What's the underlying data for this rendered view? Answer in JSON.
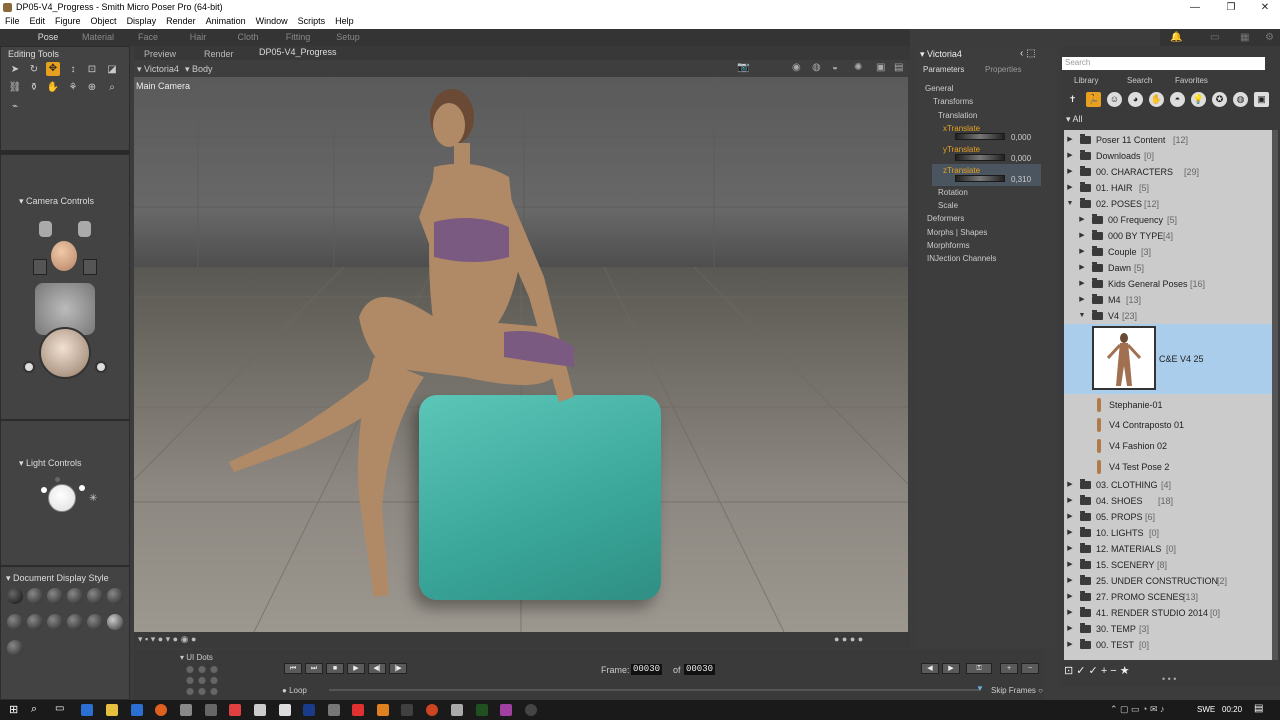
{
  "window": {
    "title": "DP05-V4_Progress - Smith Micro Poser Pro  (64-bit)"
  },
  "menu": [
    "File",
    "Edit",
    "Figure",
    "Object",
    "Display",
    "Render",
    "Animation",
    "Window",
    "Scripts",
    "Help"
  ],
  "rooms": [
    "Pose",
    "Material",
    "Face",
    "Hair",
    "Cloth",
    "Fitting",
    "Setup"
  ],
  "editing_tools": {
    "title": "Editing Tools"
  },
  "camera_controls": {
    "title": "Camera Controls"
  },
  "light_controls": {
    "title": "Light Controls"
  },
  "doc_display": {
    "title": "Document Display Style"
  },
  "viewport": {
    "tabs": [
      "Preview",
      "Render"
    ],
    "doc_name": "DP05-V4_Progress",
    "figure": "Victoria4",
    "part": "Body",
    "camera": "Main Camera"
  },
  "params": {
    "title": "Victoria4",
    "tabs": [
      "Parameters",
      "Properties"
    ],
    "general": "General",
    "transforms": "Transforms",
    "translation": "Translation",
    "xtranslate": {
      "label": "xTranslate",
      "value": "0,000"
    },
    "ytranslate": {
      "label": "yTranslate",
      "value": "0,000"
    },
    "ztranslate": {
      "label": "zTranslate",
      "value": "0,310"
    },
    "rotation": "Rotation",
    "scale": "Scale",
    "deformers": "Deformers",
    "morphs": "Morphs | Shapes",
    "morphforms": "Morphforms",
    "injection": "INJection Channels"
  },
  "library": {
    "search_placeholder": "Search",
    "tabs": [
      "Library",
      "Search",
      "Favorites"
    ],
    "all_label": "All",
    "items": [
      {
        "label": "Poser 11 Content",
        "count": "[12]"
      },
      {
        "label": "Downloads",
        "count": "[0]"
      },
      {
        "label": "00. CHARACTERS",
        "count": "[29]"
      },
      {
        "label": "01. HAIR",
        "count": "[5]"
      },
      {
        "label": "02. POSES",
        "count": "[12]"
      },
      {
        "label": "00 Frequency",
        "count": "[5]"
      },
      {
        "label": "000 BY TYPE",
        "count": "[4]"
      },
      {
        "label": "Couple",
        "count": "[3]"
      },
      {
        "label": "Dawn",
        "count": "[5]"
      },
      {
        "label": "Kids General Poses",
        "count": "[16]"
      },
      {
        "label": "M4",
        "count": "[13]"
      },
      {
        "label": "V4",
        "count": "[23]"
      }
    ],
    "selected_pose": "C&E V4 25",
    "poses": [
      "Stephanie-01",
      "V4 Contraposto 01",
      "V4 Fashion 02",
      "V4 Test Pose 2"
    ],
    "items2": [
      {
        "label": "03. CLOTHING",
        "count": "[4]"
      },
      {
        "label": "04. SHOES",
        "count": "[18]"
      },
      {
        "label": "05. PROPS",
        "count": "[6]"
      },
      {
        "label": "10. LIGHTS",
        "count": "[0]"
      },
      {
        "label": "12. MATERIALS",
        "count": "[0]"
      },
      {
        "label": "15. SCENERY",
        "count": "[8]"
      },
      {
        "label": "25. UNDER CONSTRUCTION",
        "count": "[2]"
      },
      {
        "label": "27. PROMO SCENES",
        "count": "[13]"
      },
      {
        "label": "41. RENDER STUDIO 2014",
        "count": "[0]"
      },
      {
        "label": "30. TEMP",
        "count": "[3]"
      },
      {
        "label": "00. TEST",
        "count": "[0]"
      }
    ]
  },
  "timeline": {
    "ui_dots": "UI Dots",
    "frame_label": "Frame:",
    "frame_current": "00030",
    "of_label": "of",
    "frame_total": "00030",
    "loop": "Loop",
    "skip_frames": "Skip Frames"
  },
  "taskbar": {
    "lang": "SWE",
    "time": "00:20"
  },
  "colors": {
    "accent": "#e8a020",
    "cube": "#4bb6a9",
    "selection": "#a9cdea"
  }
}
